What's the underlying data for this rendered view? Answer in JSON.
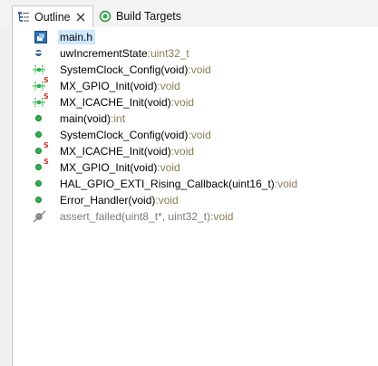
{
  "tabs": {
    "outline_label": "Outline",
    "build_targets_label": "Build Targets"
  },
  "outline": {
    "items": [
      {
        "name": "main.h",
        "type": "",
        "icon": "header-file-icon"
      },
      {
        "name": "uwIncrementState",
        "type": "uint32_t",
        "icon": "field-icon"
      },
      {
        "name": "SystemClock_Config(void)",
        "type": "void",
        "icon": "function-declaration-icon"
      },
      {
        "name": "MX_GPIO_Init(void)",
        "type": "void",
        "icon": "static-function-declaration-icon"
      },
      {
        "name": "MX_ICACHE_Init(void)",
        "type": "void",
        "icon": "static-function-declaration-icon"
      },
      {
        "name": "main(void)",
        "type": "int",
        "icon": "function-icon"
      },
      {
        "name": "SystemClock_Config(void)",
        "type": "void",
        "icon": "function-icon"
      },
      {
        "name": "MX_ICACHE_Init(void)",
        "type": "void",
        "icon": "static-function-icon"
      },
      {
        "name": "MX_GPIO_Init(void)",
        "type": "void",
        "icon": "static-function-icon"
      },
      {
        "name": "HAL_GPIO_EXTI_Rising_Callback(uint16_t)",
        "type": "void",
        "icon": "function-icon"
      },
      {
        "name": "Error_Handler(void)",
        "type": "void",
        "icon": "function-icon"
      },
      {
        "name": "assert_failed(uint8_t*, uint32_t)",
        "type": "void",
        "icon": "inactive-function-icon"
      }
    ],
    "separator": " : "
  },
  "colors": {
    "type_text": "#8b7c50",
    "selection": "#cce8ff",
    "function_green": "#2db34a",
    "field_blue": "#3f6fb8"
  }
}
